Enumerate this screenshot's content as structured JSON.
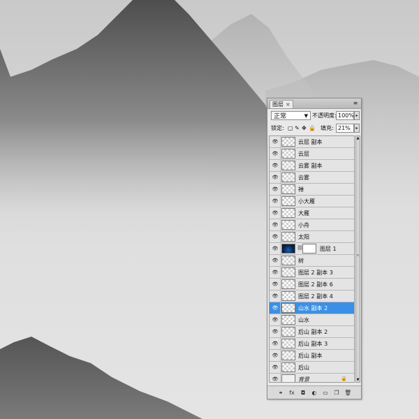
{
  "panel": {
    "tab_label": "图层",
    "close_glyph": "×",
    "menu_glyph": "≡",
    "blend_mode": "正常",
    "opacity_label": "不透明度:",
    "opacity_value": "100%",
    "lock_label": "锁定:",
    "fill_label": "填充:",
    "fill_value": "21%"
  },
  "layers": [
    {
      "name": "云层 副本",
      "thumb": "transparent"
    },
    {
      "name": "云层",
      "thumb": "transparent"
    },
    {
      "name": "云雾 副本",
      "thumb": "transparent"
    },
    {
      "name": "云雾",
      "thumb": "transparent"
    },
    {
      "name": "禅",
      "thumb": "transparent"
    },
    {
      "name": "小大雁",
      "thumb": "transparent"
    },
    {
      "name": "大雁",
      "thumb": "transparent"
    },
    {
      "name": "小舟",
      "thumb": "transparent"
    },
    {
      "name": "太阳",
      "thumb": "transparent"
    },
    {
      "name": "图层 1",
      "thumb": "blue",
      "mask": true
    },
    {
      "name": "树",
      "thumb": "transparent"
    },
    {
      "name": "图层 2 副本 3",
      "thumb": "transparent"
    },
    {
      "name": "图层 2 副本 6",
      "thumb": "transparent"
    },
    {
      "name": "图层 2 副本 4",
      "thumb": "transparent"
    },
    {
      "name": "山水 副本 2",
      "thumb": "transparent",
      "selected": true
    },
    {
      "name": "山水",
      "thumb": "transparent"
    },
    {
      "name": "后山 副本 2",
      "thumb": "transparent"
    },
    {
      "name": "后山 副本 3",
      "thumb": "transparent"
    },
    {
      "name": "后山 副本",
      "thumb": "transparent"
    },
    {
      "name": "后山",
      "thumb": "transparent"
    },
    {
      "name": "背景",
      "thumb": "plain",
      "locked": true,
      "italic": true
    }
  ],
  "bottom_icons": [
    "link-icon",
    "fx-icon",
    "mask-icon",
    "adjustment-icon",
    "folder-icon",
    "new-layer-icon",
    "trash-icon"
  ],
  "colors": {
    "selection": "#3a90e6",
    "panel_bg": "#e9e9e9"
  }
}
